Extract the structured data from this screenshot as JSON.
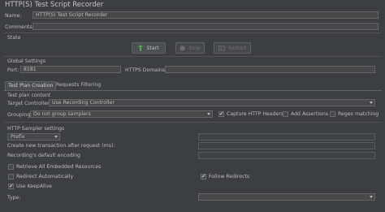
{
  "title": "HTTP(S) Test Script Recorder",
  "name": {
    "label": "Name:",
    "value": "HTTP(S) Test Script Recorder"
  },
  "comments": {
    "label": "Comments:",
    "value": ""
  },
  "state": {
    "label": "State",
    "start": "Start",
    "stop": "Stop",
    "restart": "Restart"
  },
  "global": {
    "label": "Global Settings",
    "port_label": "Port:",
    "port_value": "8181",
    "https_label": "HTTPS Domains:",
    "https_value": ""
  },
  "tabs": [
    "Test Plan Creation",
    "Requests Filtering"
  ],
  "test_plan": {
    "label": "Test plan content",
    "target_label": "Target Controller:",
    "target_value": "Use Recording Controller",
    "grouping_label": "Grouping:",
    "grouping_value": "Do not group samplers",
    "capture_label": "Capture HTTP Headers",
    "assertions_label": "Add Assertions",
    "regex_label": "Regex matching"
  },
  "sampler": {
    "label": "HTTP Sampler settings",
    "prefix_value": "Prefix",
    "prefix_field": "",
    "transaction_label": "Create new transaction after request (ms):",
    "transaction_value": "",
    "encoding_label": "Recording's default encoding",
    "encoding_value": "",
    "retrieve_label": "Retrieve All Embedded Resources",
    "redirect_label": "Redirect Automatically",
    "follow_label": "Follow Redirects",
    "keepalive_label": "Use KeepAlive",
    "type_label": "Type:",
    "type_value": ""
  },
  "checks": {
    "capture": true,
    "assertions": false,
    "regex": false,
    "retrieve": false,
    "redirect": false,
    "follow": true,
    "keepalive": true
  },
  "colors": {
    "background": "#3c3f41",
    "field": "#45494a",
    "start_icon": "#4ea84e"
  }
}
